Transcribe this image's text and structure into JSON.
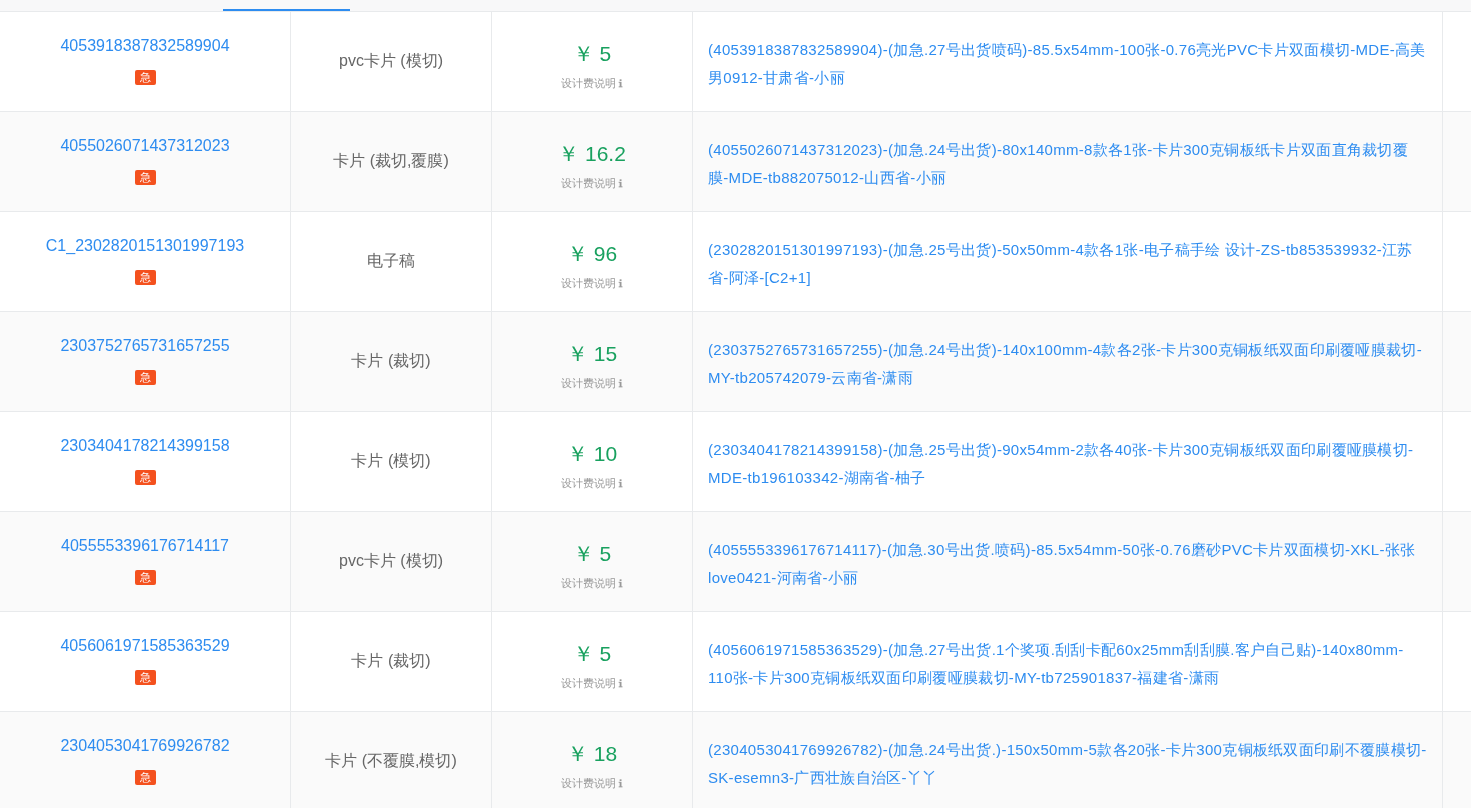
{
  "rows": [
    {
      "order_id": "4053918387832589904",
      "badge": "急",
      "product": "pvc卡片 (模切)",
      "price": "￥ 5",
      "fee_note": "设计费说明",
      "description": "(4053918387832589904)-(加急.27号出货喷码)-85.5x54mm-100张-0.76亮光PVC卡片双面模切-MDE-高美男0912-甘肃省-小丽"
    },
    {
      "order_id": "4055026071437312023",
      "badge": "急",
      "product": "卡片 (裁切,覆膜)",
      "price": "￥ 16.2",
      "fee_note": "设计费说明",
      "description": "(4055026071437312023)-(加急.24号出货)-80x140mm-8款各1张-卡片300克铜板纸卡片双面直角裁切覆膜-MDE-tb882075012-山西省-小丽"
    },
    {
      "order_id": "C1_2302820151301997193",
      "badge": "急",
      "product": "电子稿",
      "price": "￥ 96",
      "fee_note": "设计费说明",
      "description": "(2302820151301997193)-(加急.25号出货)-50x50mm-4款各1张-电子稿手绘 设计-ZS-tb853539932-江苏省-阿泽-[C2+1]"
    },
    {
      "order_id": "2303752765731657255",
      "badge": "急",
      "product": "卡片 (裁切)",
      "price": "￥ 15",
      "fee_note": "设计费说明",
      "description": "(2303752765731657255)-(加急.24号出货)-140x100mm-4款各2张-卡片300克铜板纸双面印刷覆哑膜裁切-MY-tb205742079-云南省-潇雨"
    },
    {
      "order_id": "2303404178214399158",
      "badge": "急",
      "product": "卡片 (模切)",
      "price": "￥ 10",
      "fee_note": "设计费说明",
      "description": "(2303404178214399158)-(加急.25号出货)-90x54mm-2款各40张-卡片300克铜板纸双面印刷覆哑膜模切-MDE-tb196103342-湖南省-柚子"
    },
    {
      "order_id": "4055553396176714117",
      "badge": "急",
      "product": "pvc卡片 (模切)",
      "price": "￥ 5",
      "fee_note": "设计费说明",
      "description": "(4055553396176714117)-(加急.30号出货.喷码)-85.5x54mm-50张-0.76磨砂PVC卡片双面模切-XKL-张张love0421-河南省-小丽"
    },
    {
      "order_id": "4056061971585363529",
      "badge": "急",
      "product": "卡片 (裁切)",
      "price": "￥ 5",
      "fee_note": "设计费说明",
      "description": "(4056061971585363529)-(加急.27号出货.1个奖项.刮刮卡配60x25mm刮刮膜.客户自己贴)-140x80mm-110张-卡片300克铜板纸双面印刷覆哑膜裁切-MY-tb725901837-福建省-潇雨"
    },
    {
      "order_id": "2304053041769926782",
      "badge": "急",
      "product": "卡片 (不覆膜,模切)",
      "price": "￥ 18",
      "fee_note": "设计费说明",
      "description": "(2304053041769926782)-(加急.24号出货.)-150x50mm-5款各20张-卡片300克铜板纸双面印刷不覆膜模切-SK-esemn3-广西壮族自治区-丫丫"
    }
  ]
}
